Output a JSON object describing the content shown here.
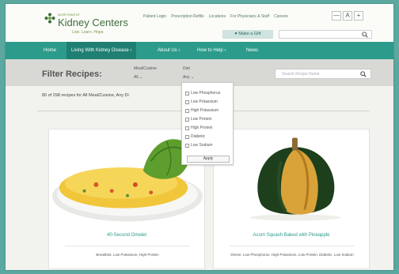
{
  "header": {
    "logo_small": "NORTHWEST",
    "logo_name": "Kidney Centers",
    "logo_tagline": "Live. Learn. Hope.",
    "top_links": [
      "Patient Login",
      "Prescription Refills",
      "Locations",
      "For Physicians & Staff",
      "Careers"
    ],
    "font_buttons": [
      "—",
      "A",
      "+"
    ],
    "gift_label": "♥ Make a Gift"
  },
  "nav": {
    "items": [
      {
        "label": "Home"
      },
      {
        "label": "Living With Kidney Disease ›"
      },
      {
        "label": "About Us ›"
      },
      {
        "label": "How to Help ›"
      },
      {
        "label": "News"
      }
    ]
  },
  "filter": {
    "title": "Filter Recipes:",
    "meal_label": "Meal/Cuisine",
    "meal_value": "All ⌄",
    "diet_label": "Diet",
    "diet_value": "Any ⌄",
    "search_placeholder": "Search Recipe Name"
  },
  "dropdown": {
    "options": [
      "Low Phosphorus",
      "Low Potassium",
      "High Potassium",
      "Low Protein",
      "High Protein",
      "Diabetic",
      "Low Sodium"
    ],
    "apply_label": "Apply"
  },
  "results_text": "80 of 298 recipes for All Meal/Cuisine, Any Di",
  "cards": [
    {
      "title": "40-Second Omelet",
      "tags": "Breakfast, Low Potassium, High Protein"
    },
    {
      "title": "Acorn Squash Baked with Pineapple",
      "tags": "Dinner, Low Phosphorus, High Potassium, Low Protein, Diabetic, Low Sodium"
    }
  ],
  "colors": {
    "brand_teal": "#2c9b8b",
    "nav_active": "#1f7f72",
    "title_teal": "#2a9a8a",
    "logo_green": "#3d6e3a"
  },
  "icons": [
    "kidney-logo-icon",
    "search-icon",
    "heart-icon"
  ]
}
